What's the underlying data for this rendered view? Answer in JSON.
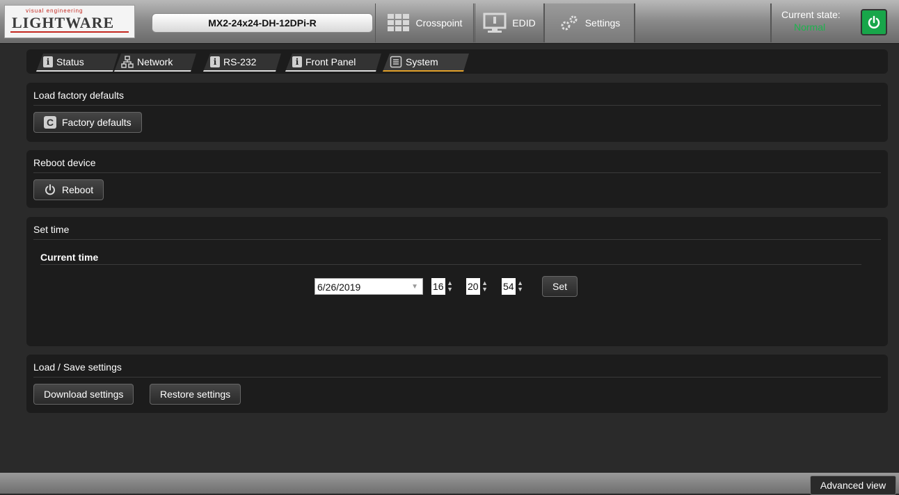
{
  "header": {
    "logo_tag": "visual engineering",
    "logo_word": "LIGHTWARE",
    "device_name": "MX2-24x24-DH-12DPi-R",
    "tabs": [
      {
        "label": "Crosspoint",
        "icon": "grid-icon"
      },
      {
        "label": "EDID",
        "icon": "monitor-icon"
      },
      {
        "label": "Settings",
        "icon": "gears-icon"
      }
    ],
    "state_label": "Current state:",
    "state_value": "Normal",
    "state_color": "#1db34d"
  },
  "subtabs": [
    {
      "label": "Status",
      "icon": "info-icon"
    },
    {
      "label": "Network",
      "icon": "network-icon"
    },
    {
      "label": "RS-232",
      "icon": "info-icon"
    },
    {
      "label": "Front Panel",
      "icon": "info-icon"
    },
    {
      "label": "System",
      "icon": "list-icon",
      "active": true
    }
  ],
  "factory": {
    "title": "Load factory defaults",
    "button_label": "Factory defaults"
  },
  "reboot": {
    "title": "Reboot device",
    "button_label": "Reboot"
  },
  "time": {
    "title": "Set time",
    "subtitle": "Current time",
    "date": "6/26/2019",
    "hour": "16",
    "minute": "20",
    "second": "54",
    "set_label": "Set"
  },
  "settings": {
    "title": "Load / Save settings",
    "download_label": "Download settings",
    "restore_label": "Restore settings"
  },
  "footer": {
    "advanced_label": "Advanced view"
  }
}
